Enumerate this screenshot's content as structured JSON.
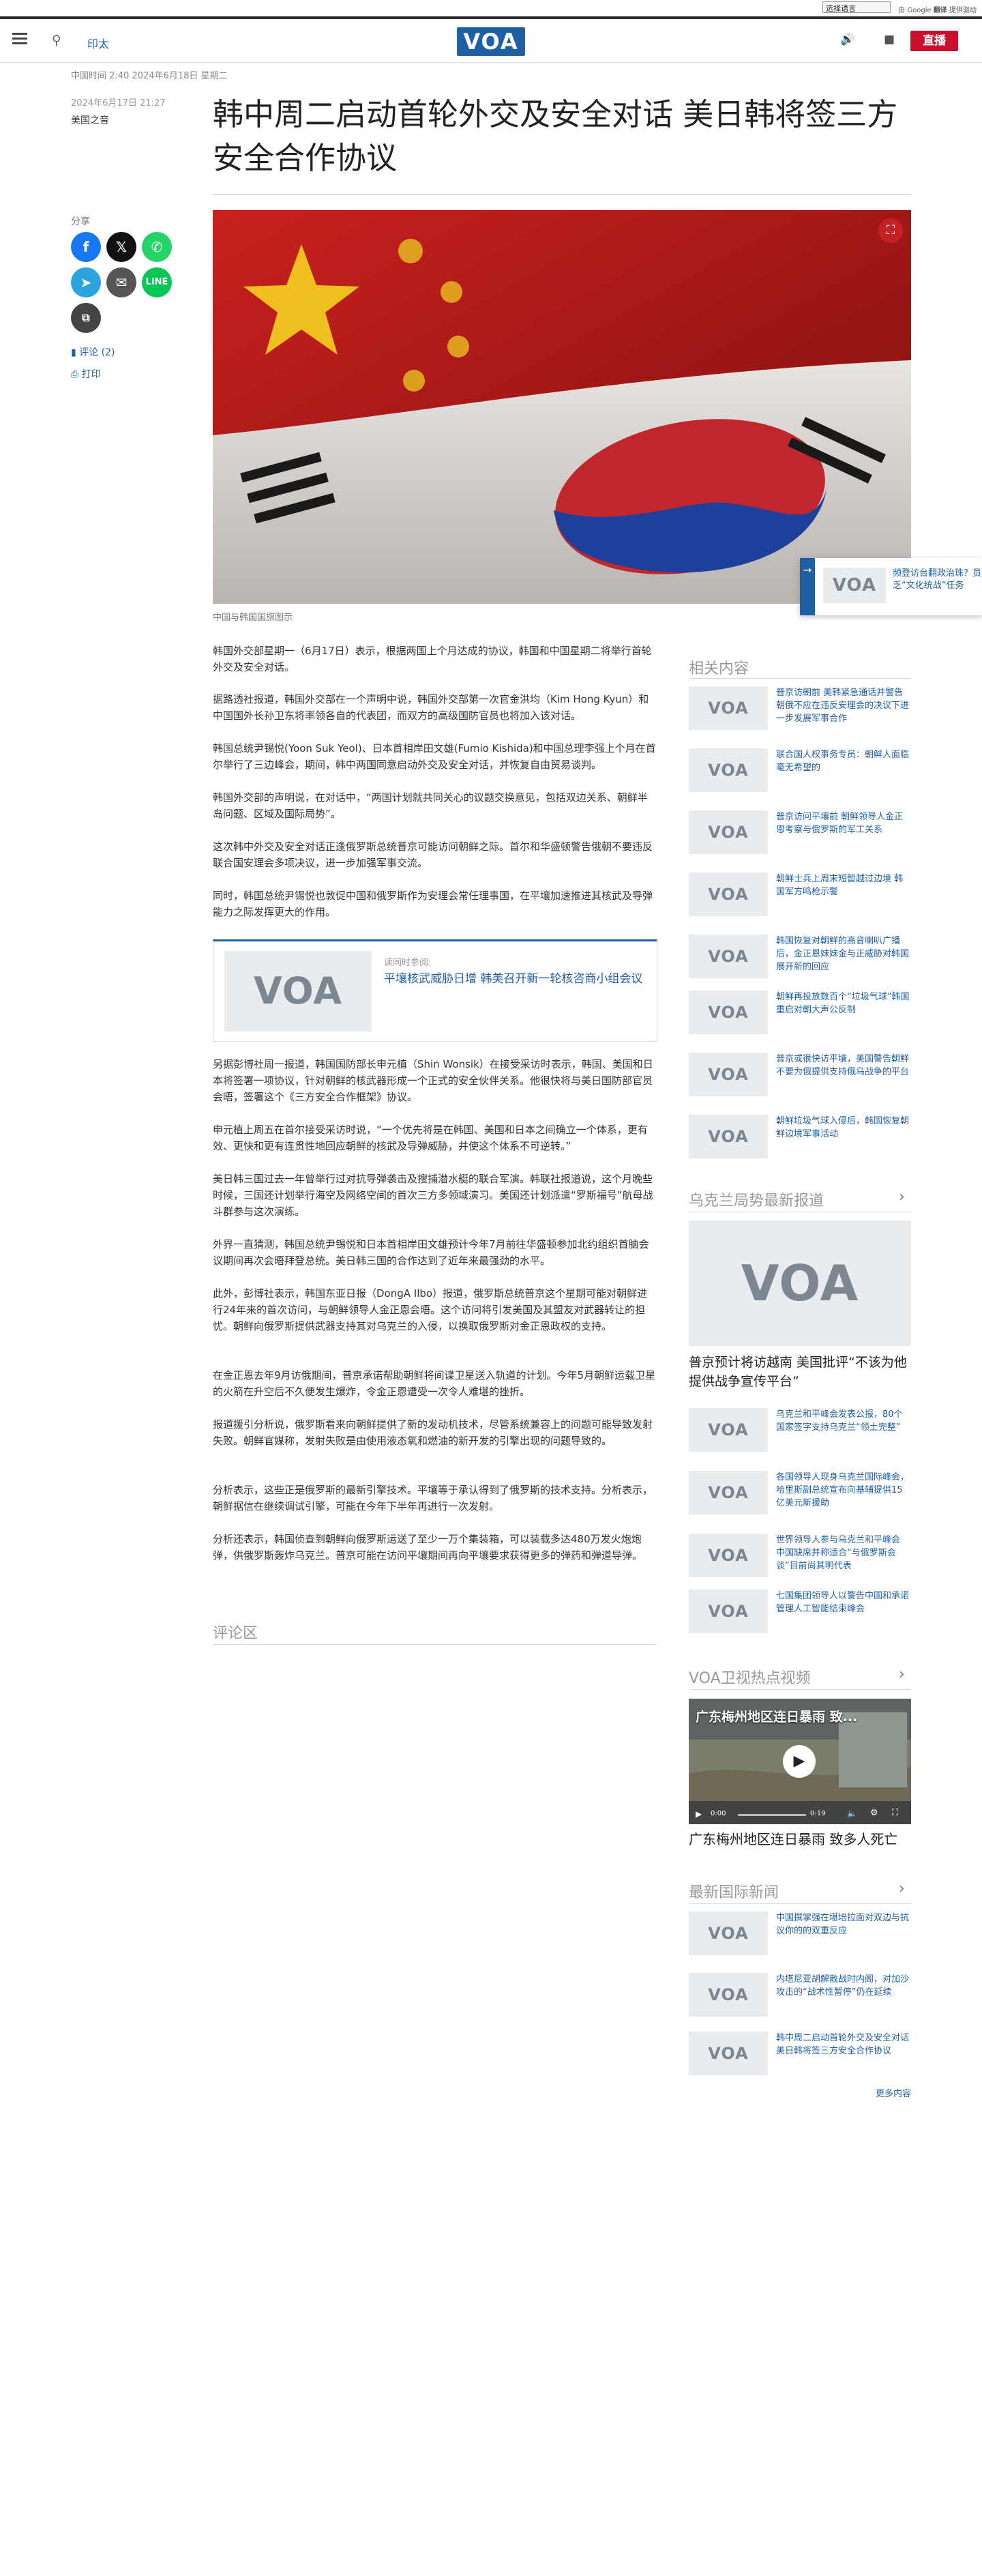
{
  "topbar": {
    "language_select": "选择语言",
    "translate_prefix": "由",
    "translate_brand": "Google",
    "translate_action": "翻译",
    "translate_suffix": "提供驱动"
  },
  "header": {
    "link": "印太",
    "logo_text": "VOA",
    "live_label": "直播"
  },
  "meta": {
    "top_line": "中国时间 2:40 2024年6月18日 星期二",
    "date": "2024年6月17日 21:27",
    "source": "美国之音"
  },
  "article": {
    "title": "韩中周二启动首轮外交及安全对话 美日韩将签三方安全合作协议",
    "image_caption": "中国与韩国国旗图示",
    "paragraphs": [
      "韩国外交部星期一（6月17日）表示，根据两国上个月达成的协议，韩国和中国星期二将举行首轮外交及安全对话。",
      "据路透社报道，韩国外交部在一个声明中说，韩国外交部第一次官金洪均（Kim Hong Kyun）和中国国外长孙卫东将率领各自的代表团，而双方的高级国防官员也将加入该对话。",
      "韩国总统尹锡悦(Yoon Suk Yeol)、日本首相岸田文雄(Fumio Kishida)和中国总理李强上个月在首尔举行了三边峰会，期间，韩中两国同意启动外交及安全对话，并恢复自由贸易谈判。",
      "韩国外交部的声明说，在对话中，“两国计划就共同关心的议题交换意见，包括双边关系、朝鲜半岛问题、区域及国际局势”。",
      "这次韩中外交及安全对话正逢俄罗斯总统普京可能访问朝鲜之际。首尔和华盛顿警告俄朝不要违反联合国安理会多项决议，进一步加强军事交流。",
      "同时，韩国总统尹锡悦也敦促中国和俄罗斯作为安理会常任理事国，在平壤加速推进其核武及导弹能力之际发挥更大的作用。",
      "另据彭博社周一报道，韩国国防部长申元植（Shin Wonsik）在接受采访时表示，韩国、美国和日本将签署一项协议，针对朝鲜的核武器形成一个正式的安全伙伴关系。他很快将与美日国防部官员会晤，签署这个《三方安全合作框架》协议。",
      "申元植上周五在首尔接受采访时说，“一个优先将是在韩国、美国和日本之间确立一个体系，更有效、更快和更有连贯性地回应朝鲜的核武及导弹威胁，并使这个体系不可逆转。”",
      "美日韩三国过去一年曾举行过对抗导弹袭击及搜捕潜水艇的联合军演。韩联社报道说，这个月晚些时候，三国还计划举行海空及网络空间的首次三方多领域演习。美国还计划派遣“罗斯福号”航母战斗群参与这次演练。",
      "外界一直猜测，韩国总统尹锡悦和日本首相岸田文雄预计今年7月前往华盛顿参加北约组织首脑会议期间再次会晤拜登总统。美日韩三国的合作达到了近年来最强劲的水平。",
      "此外，彭博社表示，韩国东亚日报（DongA Ilbo）报道，俄罗斯总统普京这个星期可能对朝鲜进行24年来的首次访问，与朝鲜领导人金正恩会晤。这个访问将引发美国及其盟友对武器转让的担忧。朝鲜向俄罗斯提供武器支持其对乌克兰的入侵，以换取俄罗斯对金正恩政权的支持。",
      "在金正恩去年9月访俄期间，普京承诺帮助朝鲜将间谍卫星送入轨道的计划。今年5月朝鲜运载卫星的火箭在升空后不久便发生爆炸，令金正恩遭受一次令人难堪的挫折。",
      "报道援引分析说，俄罗斯看来向朝鲜提供了新的发动机技术，尽管系统兼容上的问题可能导致发射失败。朝鲜官媒称，发射失败是由使用液态氧和燃油的新开发的引擎出现的问题导致的。",
      "分析表示，这些正是俄罗斯的最新引擎技术。平壤等于承认得到了俄罗斯的技术支持。分析表示，朝鲜据信在继续调试引擎，可能在今年下半年再进行一次发射。",
      "分析还表示，韩国侦查到朝鲜向俄罗斯运送了至少一万个集装箱，可以装载多达480万发火炮炮弹，供俄罗斯轰炸乌克兰。普京可能在访问平壤期间再向平壤要求获得更多的弹药和弹道导弹。"
    ],
    "related_label": "读同时参阅:",
    "related_title": "平壤核武威胁日增 韩美召开新一轮核咨商小组会议"
  },
  "share": {
    "label": "分享",
    "comments": "评论 (2)",
    "print": "打印"
  },
  "float_card": {
    "text": "频登访台翻政治珠？员救乏“文化统战”任务"
  },
  "comments": {
    "heading": "评论区"
  },
  "sidebar": {
    "related": {
      "heading": "相关内容",
      "items": [
        "普京访朝前 美韩紧急通话并警告朝俄不应在违反安理会的决议下进一步发展军事合作",
        "联合国人权事务专员：朝鲜人面临毫无希望的",
        "普京访问平壤前 朝鲜领导人金正恩考察与俄罗斯的军工关系",
        "朝鲜士兵上周末短暂越过边境 韩国军方鸣枪示警",
        "韩国恢复对朝鲜的高音喇叭广播后，金正恩妹妹金与正威胁对韩国展开新的回应",
        "朝鲜再投放数百个“垃圾气球”韩国重启对朝大声公反制",
        "普京或很快访平壤，美国警告朝鲜不要为俄提供支持俄乌战争的平台",
        "朝鲜垃圾气球入侵后，韩国恢复朝鲜边境军事活动"
      ]
    },
    "ukraine": {
      "heading": "乌克兰局势最新报道",
      "feature_title": "普京预计将访越南 美国批评“不该为他提供战争宣传平台”",
      "items": [
        "乌克兰和平峰会发表公报，80个国家签字支持乌克兰“领土完整”",
        "各国领导人现身乌克兰国际峰会，哈里斯副总统宣布向基辅提供15亿美元新援助",
        "世界领导人参与乌克兰和平峰会 中国缺席并称适合“与俄罗斯会谈”目前尚其明代表",
        "七国集团领导人以警告中国和承诺管理人工智能结束峰会"
      ]
    },
    "video": {
      "heading": "VOA卫视热点视频",
      "overlay_title": "广东梅州地区连日暴雨 致...",
      "time_current": "0:00",
      "time_total": "0:19",
      "title": "广东梅州地区连日暴雨 致多人死亡"
    },
    "intl": {
      "heading": "最新国际新闻",
      "items": [
        "中国撰掌强在堪培拉面对双边与抗议你的的双重反应",
        "内塔尼亚胡解散战时内阁，对加沙攻击的“战术性暂停”仍在延续",
        "韩中周二启动首轮外交及安全对话 美日韩将签三方安全合作协议"
      ],
      "more": "更多内容"
    }
  },
  "colors": {
    "brand": "#1f5fa5",
    "live": "#c8102e",
    "facebook": "#1877f2",
    "x": "#111111",
    "whatsapp": "#25d366",
    "telegram": "#2aa3df",
    "email": "#555555",
    "line": "#06c755",
    "copy": "#444444"
  }
}
